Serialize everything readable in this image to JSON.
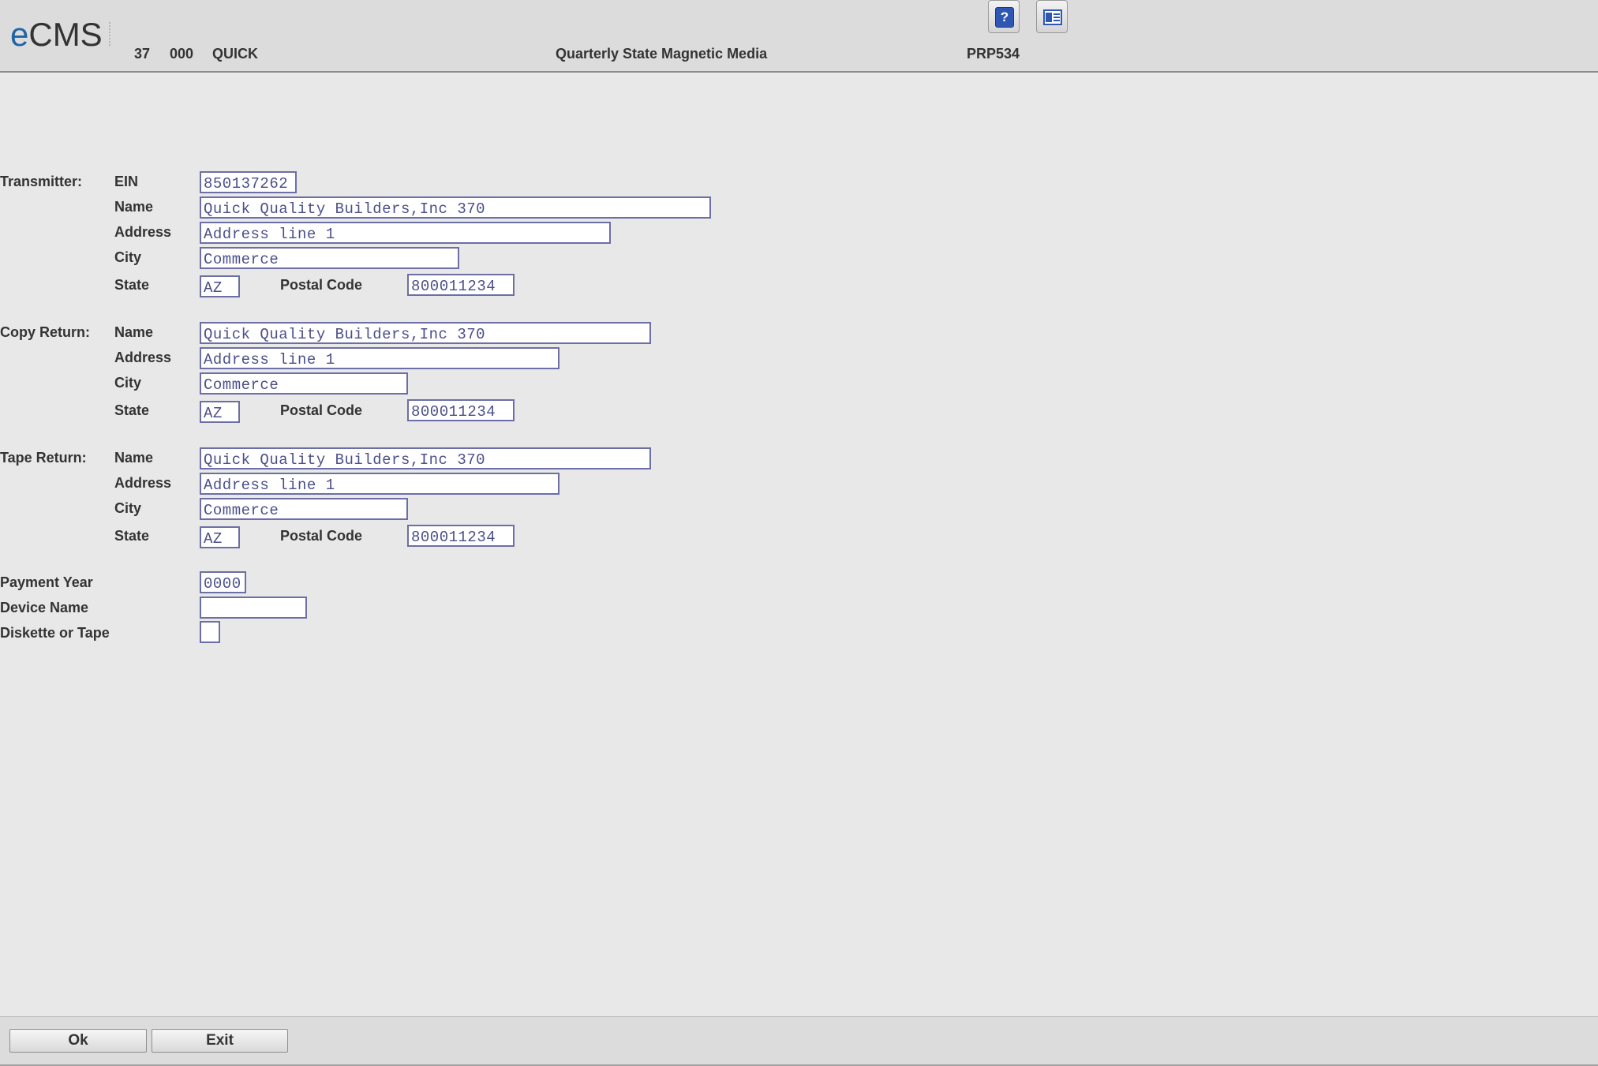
{
  "header": {
    "logo_e": "e",
    "logo_rest": "CMS",
    "company_no": "37",
    "division_no": "000",
    "user": "QUICK",
    "screen_title": "Quarterly State Magnetic Media",
    "program_id": "PRP534"
  },
  "toolbar": {
    "help_glyph": "?",
    "help_icon": "help-icon",
    "excel_icon": "excel-export-icon"
  },
  "transmitter": {
    "section_label": "Transmitter:",
    "ein_label": "EIN",
    "ein": "850137262",
    "name_label": "Name",
    "name": "Quick Quality Builders,Inc 370",
    "address_label": "Address",
    "address": "Address line 1",
    "city_label": "City",
    "city": "Commerce",
    "state_label": "State",
    "state": "AZ",
    "postal_label": "Postal Code",
    "postal": "800011234"
  },
  "copy_return": {
    "section_label": "Copy Return:",
    "name_label": "Name",
    "name": "Quick Quality Builders,Inc 370",
    "address_label": "Address",
    "address": "Address line 1",
    "city_label": "City",
    "city": "Commerce",
    "state_label": "State",
    "state": "AZ",
    "postal_label": "Postal Code",
    "postal": "800011234"
  },
  "tape_return": {
    "section_label": "Tape Return:",
    "name_label": "Name",
    "name": "Quick Quality Builders,Inc 370",
    "address_label": "Address",
    "address": "Address line 1",
    "city_label": "City",
    "city": "Commerce",
    "state_label": "State",
    "state": "AZ",
    "postal_label": "Postal Code",
    "postal": "800011234"
  },
  "options": {
    "payment_year_label": "Payment Year",
    "payment_year": "0000",
    "device_name_label": "Device Name",
    "device_name": "",
    "media_label": "Diskette or Tape",
    "media": ""
  },
  "footer": {
    "ok_label": "Ok",
    "exit_label": "Exit"
  }
}
